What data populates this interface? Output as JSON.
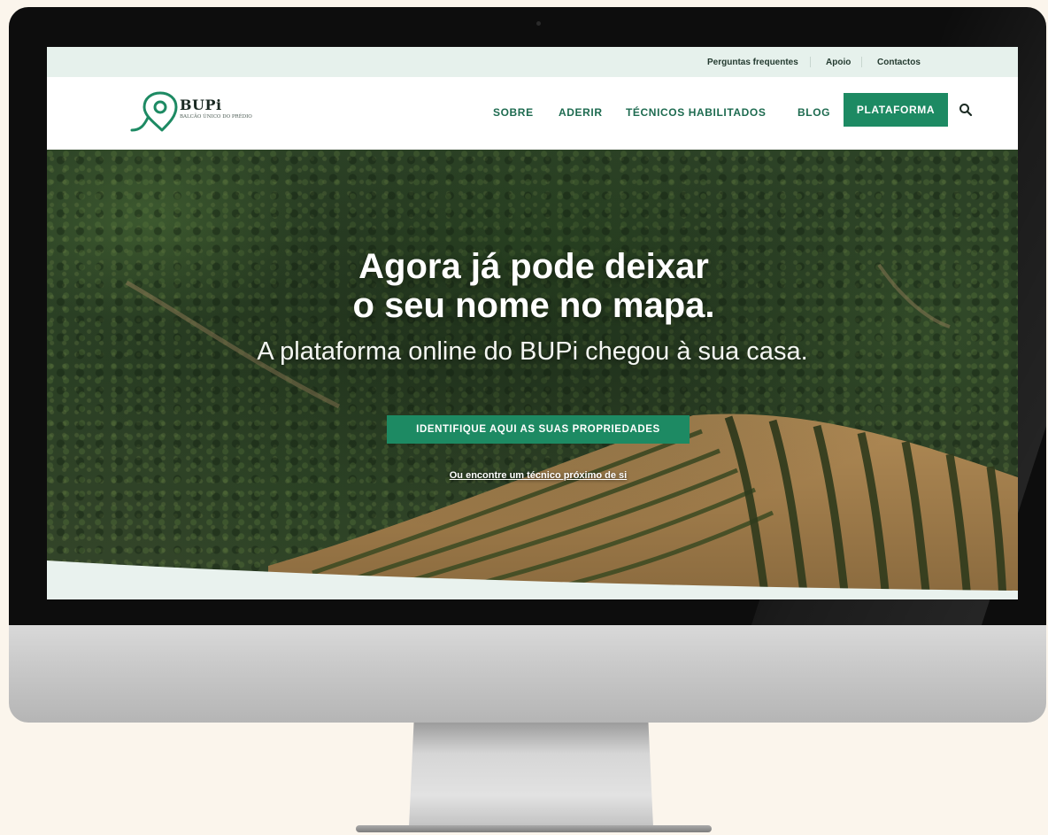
{
  "topbar": {
    "links": [
      "Perguntas frequentes",
      "Apoio",
      "Contactos"
    ]
  },
  "header": {
    "logo_title": "BUPi",
    "logo_subtitle": "BALCÃO ÚNICO DO PRÉDIO",
    "nav": [
      "SOBRE",
      "ADERIR",
      "TÉCNICOS HABILITADOS",
      "BLOG"
    ],
    "platform_button": "PLATAFORMA",
    "search_icon": "search-icon"
  },
  "hero": {
    "title_line1": "Agora já pode deixar",
    "title_line2": "o seu nome no mapa.",
    "subtitle": "A plataforma online do BUPi chegou à sua casa.",
    "cta_label": "IDENTIFIQUE AQUI AS SUAS PROPRIEDADES",
    "link_label": "Ou encontre um técnico próximo de si"
  },
  "colors": {
    "brand_green": "#1d8a63",
    "nav_text": "#1e6b50",
    "page_background": "#fbf5ec"
  }
}
